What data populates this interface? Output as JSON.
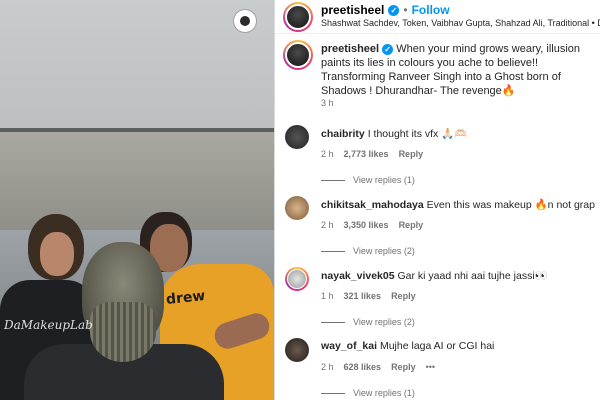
{
  "media": {
    "watermark": "DaMakeupLab",
    "shirt_text": "drew"
  },
  "header": {
    "username": "preetisheel",
    "separator": "•",
    "follow_label": "Follow",
    "subtitle": "Shashwat Sachdev, Token, Vaibhav Gupta, Shahzad Ali, Traditional • Dest"
  },
  "caption": {
    "username": "preetisheel",
    "text": "When your mind grows weary, illusion paints its lies in colours you ache to believe!! Transforming Ranveer Singh into a Ghost born of Shadows ! Dhurandhar- The revenge🔥",
    "time": "3 h"
  },
  "comments": [
    {
      "username": "chaibrity",
      "text": "I thought its vfx 🙏🏻🫶🏻",
      "time": "2 h",
      "likes": "2,773 likes",
      "reply": "Reply",
      "more": "View replies (1)"
    },
    {
      "username": "chikitsak_mahodaya",
      "text": "Even this was makeup 🔥n not graphics🙌",
      "time": "2 h",
      "likes": "3,350 likes",
      "reply": "Reply",
      "more": "View replies (2)"
    },
    {
      "username": "nayak_vivek05",
      "text": "Gar ki yaad nhi aai tujhe jassi👀",
      "time": "1 h",
      "likes": "321 likes",
      "reply": "Reply",
      "more": "View replies (2)"
    },
    {
      "username": "way_of_kai",
      "text": "Mujhe laga AI or CGI hai",
      "time": "2 h",
      "likes": "628 likes",
      "reply": "Reply",
      "options": "•••",
      "more": "View replies (1)"
    }
  ],
  "colors": {
    "accent": "#0095f6",
    "muted": "#737373"
  }
}
